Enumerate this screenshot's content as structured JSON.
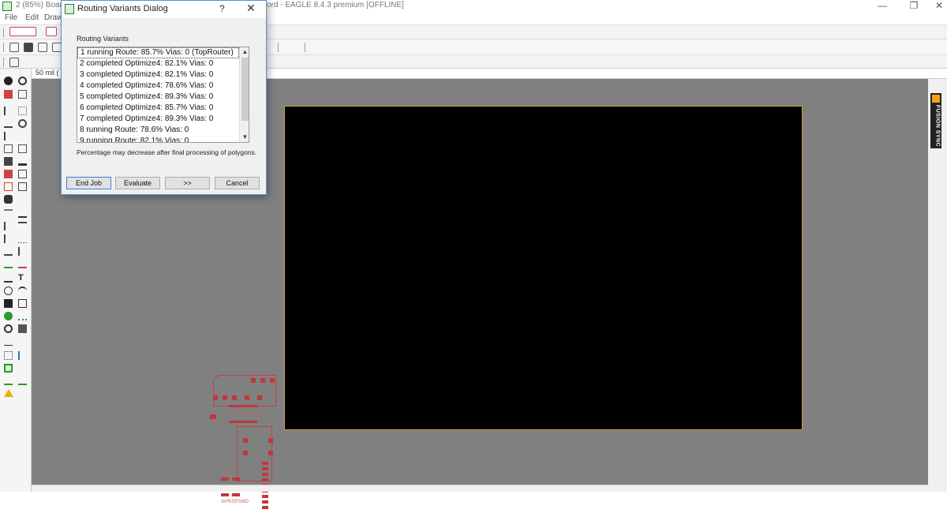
{
  "app": {
    "title_left": "2 (85%) Board",
    "title_right": "ord - EAGLE 8.4.3 premium [OFFLINE]",
    "menu": [
      "File",
      "Edit",
      "Draw"
    ]
  },
  "toolbar": {
    "grid_label": "50 mil (",
    "help_glyph": "?"
  },
  "right_panel": {
    "fusion_label": "FUSION SYNC"
  },
  "dialog": {
    "title": "Routing Variants Dialog",
    "help_glyph": "?",
    "close_glyph": "✕",
    "group_label": "Routing Variants",
    "variants": [
      "1 running Route:  85.7%  Vias: 0 (TopRouter)",
      "2 completed Optimize4:  82.1%  Vias: 0",
      "3 completed Optimize4:  82.1%  Vias: 0",
      "4 completed Optimize4:  78.6%  Vias: 0",
      "5 completed Optimize4:  89.3%  Vias: 0",
      "6 completed Optimize4:  85.7%  Vias: 0",
      "7 completed Optimize4:  89.3%  Vias: 0",
      "8 running Route:  78.6%  Vias: 0",
      "9 running Route:  82.1%  Vias: 0"
    ],
    "note": "Percentage may decrease after final processing of polygons.",
    "buttons": {
      "end_job": "End Job",
      "evaluate": "Evaluate",
      "next": ">>",
      "cancel": "Cancel"
    }
  },
  "pcb": {
    "labels": [
      "AVRISPSMD",
      "U$1",
      "ATTINY44-SSU"
    ]
  },
  "colors": {
    "board": "#000000",
    "board_outline": "#c8a23a",
    "canvas": "#808080",
    "pad": "#c0383c"
  }
}
